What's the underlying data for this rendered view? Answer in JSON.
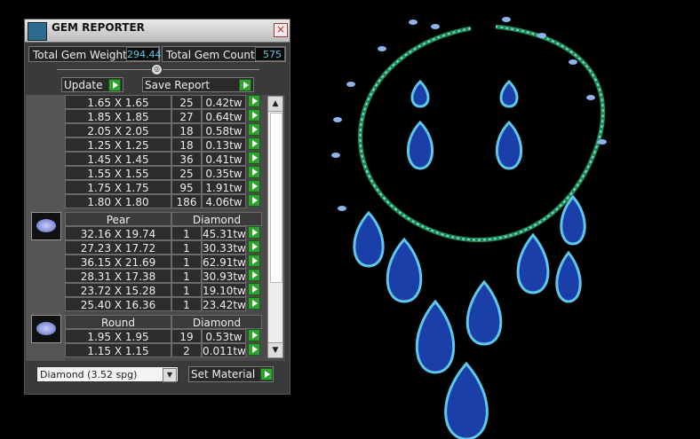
{
  "window": {
    "title": "GEM REPORTER",
    "close": "×"
  },
  "stats": {
    "weight_label": "Total Gem Weight",
    "weight_value": "294.44",
    "count_label": "Total Gem Count",
    "count_value": "575"
  },
  "slider": {
    "knob": "◎"
  },
  "buttons": {
    "update": "Update",
    "save": "Save Report",
    "set_material": "Set Material"
  },
  "rows_top": [
    {
      "size": "1.65 X 1.65",
      "count": "25",
      "weight": "0.42tw"
    },
    {
      "size": "1.85 X 1.85",
      "count": "27",
      "weight": "0.64tw"
    },
    {
      "size": "2.05 X 2.05",
      "count": "18",
      "weight": "0.58tw"
    },
    {
      "size": "1.25 X 1.25",
      "count": "18",
      "weight": "0.13tw"
    },
    {
      "size": "1.45 X 1.45",
      "count": "36",
      "weight": "0.41tw"
    },
    {
      "size": "1.55 X 1.55",
      "count": "25",
      "weight": "0.35tw"
    },
    {
      "size": "1.75 X 1.75",
      "count": "95",
      "weight": "1.91tw"
    },
    {
      "size": "1.80 X 1.80",
      "count": "186",
      "weight": "4.06tw"
    }
  ],
  "group_pear": {
    "shape": "Pear",
    "material": "Diamond",
    "rows": [
      {
        "size": "32.16 X 19.74",
        "count": "1",
        "weight": "45.31tw"
      },
      {
        "size": "27.23 X 17.72",
        "count": "1",
        "weight": "30.33tw"
      },
      {
        "size": "36.15 X 21.69",
        "count": "1",
        "weight": "62.91tw"
      },
      {
        "size": "28.31 X 17.38",
        "count": "1",
        "weight": "30.93tw"
      },
      {
        "size": "23.72 X 15.28",
        "count": "1",
        "weight": "19.10tw"
      },
      {
        "size": "25.40 X 16.36",
        "count": "1",
        "weight": "23.42tw"
      }
    ]
  },
  "group_round": {
    "shape": "Round",
    "material": "Diamond",
    "rows": [
      {
        "size": "1.95 X 1.95",
        "count": "19",
        "weight": "0.53tw"
      },
      {
        "size": "1.15 X 1.15",
        "count": "2",
        "weight": "0.011tw"
      }
    ]
  },
  "material_select": {
    "value": "Diamond     (3.52 spg)"
  },
  "scroll": {
    "up": "▲",
    "down": "▼"
  },
  "colors": {
    "accent_value": "#5ec6e8",
    "go_button": "#2fa32f",
    "sapphire": "#1b3fa8",
    "setting": "#1e8a4c"
  }
}
